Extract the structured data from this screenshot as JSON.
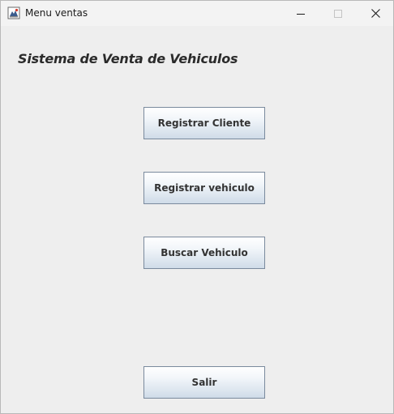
{
  "window": {
    "title": "Menu ventas",
    "icon": "java-app-icon",
    "controls": [
      "minimize-icon",
      "maximize-icon",
      "close-icon"
    ]
  },
  "main": {
    "heading": "Sistema de Venta de Vehiculos",
    "buttons": {
      "registrar_cliente": "Registrar Cliente",
      "registrar_vehiculo": "Registrar vehiculo",
      "buscar_vehiculo": "Buscar Vehiculo",
      "salir": "Salir"
    }
  }
}
